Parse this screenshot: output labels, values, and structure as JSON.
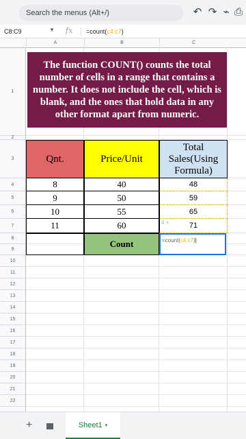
{
  "toolbar": {
    "search_placeholder": "Search the menus (Alt+/)",
    "undo_icon": "↶",
    "redo_icon": "↷",
    "paint_format_icon": "⌁",
    "print_icon": "⎙"
  },
  "formula_bar": {
    "name_box": "C8:C9",
    "fx": "fx",
    "formula_prefix": "=count(",
    "formula_range": "c4:c7",
    "formula_suffix": ")"
  },
  "columns": [
    "A",
    "B",
    "C"
  ],
  "rows": [
    "1",
    "2",
    "3",
    "4",
    "5",
    "6",
    "7",
    "8",
    "9",
    "10",
    "11",
    "12",
    "13",
    "14",
    "15",
    "16",
    "17",
    "18",
    "19",
    "20",
    "21",
    "22"
  ],
  "title_text": "The function COUNT() counts the total number of cells in a range that contains a number. It does not include the cell, which is blank, and the ones that hold data in any other format apart from numeric.",
  "table": {
    "headers": [
      "Qnt.",
      "Price/Unit",
      "Total Sales(Using Formula)"
    ],
    "rows": [
      {
        "qnt": "8",
        "price": "40",
        "total": "48"
      },
      {
        "qnt": "9",
        "price": "50",
        "total": "59"
      },
      {
        "qnt": "10",
        "price": "55",
        "total": "65"
      },
      {
        "qnt": "11",
        "price": "60",
        "total": "71"
      }
    ],
    "count_label": "Count"
  },
  "edit": {
    "prefix": "=count(",
    "range": "c4:c7",
    "suffix": ")",
    "preview": "4 ×"
  },
  "sheets": {
    "add_icon": "+",
    "active_tab": "Sheet1",
    "caret": "▾"
  },
  "colors": {
    "title_bg": "#741b47",
    "qnt_bg": "#e06666",
    "price_bg": "#ffff00",
    "total_bg": "#cfe2f3",
    "count_bg": "#93c47d",
    "range_highlight": "#f4b400",
    "selection": "#1a73e8"
  }
}
